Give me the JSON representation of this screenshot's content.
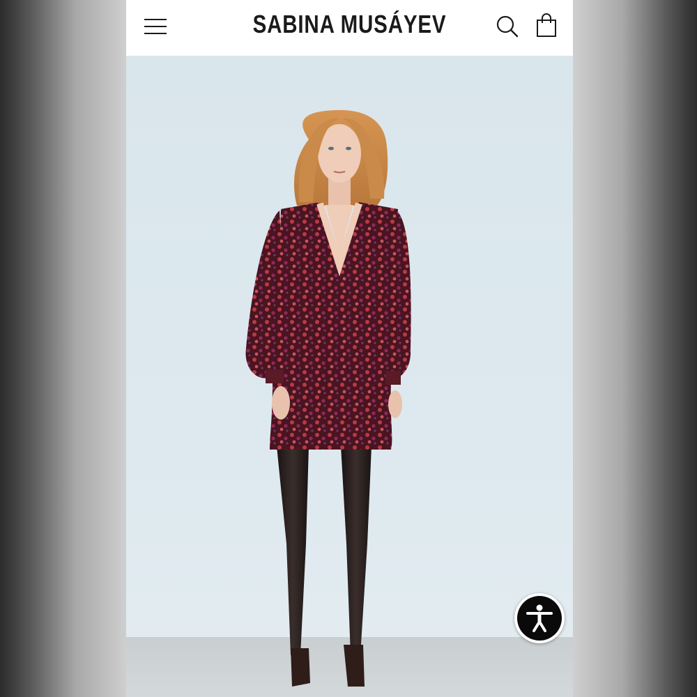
{
  "header": {
    "brand": "SABINA MUSÁYEV",
    "menu_icon": "hamburger-menu-icon",
    "search_icon": "search-icon",
    "cart_icon": "shopping-bag-icon"
  },
  "hero": {
    "image_subject": "model-wearing-floral-print-mini-dress"
  },
  "accessibility": {
    "icon": "accessibility-person-icon"
  },
  "colors": {
    "header_bg": "#ffffff",
    "brand_text": "#1a1a1a",
    "backdrop": "#dde9ef",
    "dress": "#6b1f2c",
    "hair": "#c98a4a",
    "a11y_bg": "#0a0a0a"
  }
}
